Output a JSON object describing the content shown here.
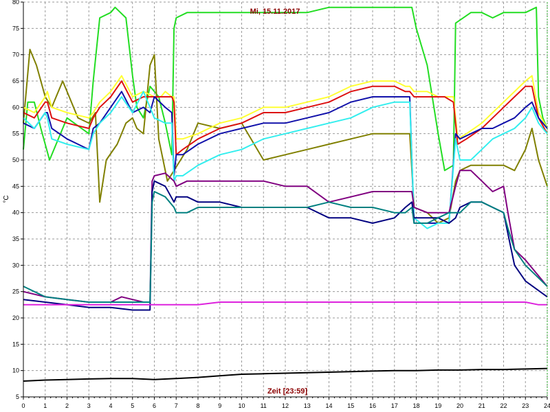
{
  "chart_data": {
    "type": "line",
    "title": "Mi, 15.11.2017",
    "xlabel": "Zeit [23:59]",
    "ylabel": "°C",
    "xlim": [
      0,
      24
    ],
    "ylim": [
      5,
      80
    ],
    "xticks": [
      0,
      1,
      2,
      3,
      4,
      5,
      6,
      7,
      8,
      9,
      10,
      11,
      12,
      13,
      14,
      15,
      16,
      17,
      18,
      19,
      20,
      21,
      22,
      23,
      24
    ],
    "yticks": [
      5,
      10,
      15,
      20,
      25,
      30,
      35,
      40,
      45,
      50,
      55,
      60,
      65,
      70,
      75,
      80
    ],
    "grid": true,
    "series": [
      {
        "color": "#22dd22",
        "x": [
          0,
          0.2,
          0.5,
          0.8,
          1.2,
          2,
          3,
          3.2,
          3.5,
          4,
          4.2,
          4.7,
          5,
          5.2,
          5.5,
          5.8,
          6.2,
          6.5,
          6.8,
          6.9,
          7,
          7.5,
          10,
          13,
          14,
          15,
          16,
          17,
          17.8,
          18,
          18.5,
          19,
          19.3,
          19.7,
          19.8,
          20.5,
          21,
          21.5,
          22,
          22.5,
          23,
          23.5,
          23.6,
          23.8,
          24
        ],
        "y": [
          52,
          61,
          61,
          56,
          50,
          58,
          55,
          65,
          77,
          78,
          79,
          77,
          66,
          60,
          58,
          64,
          62,
          57,
          51,
          75,
          77,
          78,
          78,
          78,
          79,
          79,
          79,
          79,
          79,
          75,
          68,
          55,
          48,
          49,
          76,
          78,
          78,
          77,
          78,
          78,
          78,
          79,
          62,
          58,
          56
        ]
      },
      {
        "color": "#808000",
        "x": [
          0,
          0.3,
          0.6,
          1,
          1.3,
          1.8,
          2.5,
          3,
          3.3,
          3.5,
          3.8,
          4.3,
          4.7,
          5,
          5.2,
          5.5,
          5.8,
          6,
          6.2,
          6.4,
          6.6,
          6.9,
          7.5,
          8,
          9,
          10,
          11,
          12,
          13,
          14,
          15,
          16,
          17,
          17.7,
          17.9,
          18.5,
          19,
          19.5,
          19.8,
          20,
          20.5,
          21,
          22,
          22.5,
          23,
          23.3,
          23.6,
          24
        ],
        "y": [
          57,
          71,
          68,
          62,
          60,
          65,
          58,
          57,
          59,
          42,
          50,
          53,
          57,
          58,
          56,
          55,
          68,
          70,
          54,
          50,
          46,
          48,
          52,
          57,
          56,
          57,
          50,
          51,
          52,
          53,
          54,
          55,
          55,
          55,
          41,
          40,
          38,
          39,
          46,
          48,
          49,
          49,
          49,
          48,
          52,
          56,
          50,
          45
        ]
      },
      {
        "color": "#ffff33",
        "x": [
          0,
          0.5,
          1,
          1.1,
          1.3,
          2,
          3,
          3.2,
          3.5,
          4,
          4.5,
          5,
          5.5,
          6,
          6.3,
          6.5,
          6.8,
          6.9,
          7,
          7.3,
          8,
          9,
          10,
          11,
          12,
          13,
          14,
          15,
          16,
          17,
          17.5,
          17.7,
          17.9,
          18.5,
          19,
          19.3,
          19.7,
          19.9,
          20.3,
          21,
          21.5,
          22,
          22.5,
          23,
          23.3,
          23.6,
          24
        ],
        "y": [
          60,
          59,
          62,
          63,
          60,
          59,
          58,
          59,
          61,
          63,
          66,
          62,
          63,
          62,
          62,
          63,
          62,
          62,
          54,
          54,
          55,
          57,
          58,
          60,
          60,
          61,
          62,
          64,
          65,
          65,
          64,
          64,
          63,
          63,
          62,
          62,
          62,
          54,
          55,
          57,
          59,
          61,
          63,
          65,
          66,
          59,
          56
        ]
      },
      {
        "color": "#dd1111",
        "x": [
          0,
          0.5,
          1,
          1.1,
          1.3,
          2,
          3,
          3.2,
          3.5,
          4,
          4.5,
          5,
          5.5,
          6,
          6.3,
          6.5,
          6.8,
          6.9,
          7,
          7.3,
          8,
          9,
          10,
          11,
          12,
          13,
          14,
          15,
          16,
          17,
          17.5,
          17.7,
          17.9,
          18.5,
          19,
          19.3,
          19.7,
          19.9,
          20.3,
          21,
          21.5,
          22,
          22.5,
          23,
          23.3,
          23.6,
          24
        ],
        "y": [
          59,
          58,
          61,
          61,
          58,
          57,
          56,
          58,
          60,
          62,
          65,
          61,
          62,
          62,
          62,
          62,
          62,
          61,
          51,
          52,
          54,
          56,
          57,
          59,
          59,
          60,
          61,
          63,
          64,
          64,
          63,
          63,
          62,
          62,
          62,
          62,
          61,
          53,
          54,
          56,
          58,
          60,
          62,
          64,
          64,
          58,
          55
        ]
      },
      {
        "color": "#1111aa",
        "x": [
          0,
          0.5,
          1,
          1.1,
          1.3,
          2,
          3,
          3.2,
          3.5,
          4,
          4.5,
          5,
          5.5,
          5.8,
          6,
          6.5,
          6.8,
          6.9,
          7,
          7.3,
          8,
          9,
          10,
          11,
          12,
          13,
          14,
          15,
          16,
          17,
          17.7,
          17.9,
          18.5,
          19,
          19.5,
          19.8,
          20,
          20.5,
          21,
          21.5,
          22,
          22.5,
          23,
          23.3,
          23.6,
          24
        ],
        "y": [
          57,
          56,
          59,
          59,
          56,
          54,
          52,
          56,
          57,
          60,
          63,
          59,
          60,
          59,
          62,
          60,
          59,
          47,
          51,
          51,
          53,
          55,
          56,
          57,
          57,
          58,
          59,
          61,
          62,
          62,
          62,
          38,
          38,
          38,
          38,
          55,
          54,
          55,
          56,
          56,
          57,
          58,
          60,
          61,
          58,
          56
        ]
      },
      {
        "color": "#33eeee",
        "x": [
          0,
          0.5,
          1,
          1.1,
          1.3,
          2,
          3,
          3.2,
          3.5,
          4,
          4.5,
          5,
          5.5,
          5.8,
          6,
          6.5,
          6.8,
          6.9,
          7,
          7.3,
          8,
          9,
          10,
          11,
          12,
          13,
          14,
          15,
          16,
          17,
          17.7,
          17.9,
          18.5,
          19,
          19.5,
          19.8,
          20,
          20.5,
          21,
          21.5,
          22,
          22.5,
          23,
          23.3,
          23.6,
          24
        ],
        "y": [
          58,
          56,
          59,
          58,
          54,
          53,
          52,
          55,
          57,
          59,
          62,
          59,
          63,
          60,
          58,
          57,
          57,
          46,
          47,
          47,
          49,
          51,
          52,
          54,
          55,
          56,
          57,
          58,
          60,
          61,
          61,
          39,
          37,
          38,
          38,
          54,
          50,
          50,
          52,
          54,
          55,
          56,
          58,
          60,
          57,
          55
        ]
      },
      {
        "color": "#800080",
        "x": [
          0,
          1,
          2,
          3,
          4,
          4.5,
          5,
          5.5,
          5.8,
          5.9,
          6,
          6.5,
          6.9,
          7,
          7.5,
          8,
          9,
          10,
          11,
          12,
          13,
          14,
          15,
          16,
          17,
          17.5,
          17.8,
          17.9,
          18.5,
          19,
          19.5,
          19.8,
          20,
          20.5,
          21,
          21.5,
          22,
          22.2,
          22.5,
          23,
          24
        ],
        "y": [
          25,
          24,
          23.5,
          23,
          23,
          24,
          23.5,
          23,
          23,
          46,
          47,
          47.5,
          46,
          45,
          46,
          46,
          46,
          46,
          46,
          45,
          45,
          42,
          43,
          44,
          44,
          44,
          44,
          41,
          40,
          40,
          40,
          45,
          48,
          48,
          46,
          44,
          45,
          40,
          33,
          31,
          26
        ]
      },
      {
        "color": "#000080",
        "x": [
          0,
          1,
          2,
          3,
          4,
          5,
          5.8,
          5.9,
          6,
          6.5,
          6.9,
          7,
          7.5,
          8,
          9,
          10,
          11,
          12,
          13,
          14,
          15,
          16,
          17,
          17.5,
          17.8,
          17.9,
          18.5,
          19,
          19.5,
          19.8,
          20,
          20.5,
          21,
          21.5,
          22,
          22.2,
          22.5,
          23,
          24
        ],
        "y": [
          23.5,
          23,
          22.5,
          22,
          22,
          21.5,
          21.5,
          44,
          46,
          45,
          42,
          43,
          43,
          42,
          42,
          41,
          41,
          41,
          41,
          39,
          39,
          38,
          39,
          41,
          42,
          39,
          39,
          39,
          38,
          39,
          41,
          42,
          42,
          41,
          40,
          36,
          30,
          27,
          24
        ]
      },
      {
        "color": "#008080",
        "x": [
          0,
          1,
          2,
          3,
          4,
          5,
          5.8,
          5.9,
          6,
          6.5,
          6.9,
          7,
          7.5,
          8,
          9,
          10,
          11,
          12,
          13,
          14,
          15,
          16,
          17,
          17.5,
          17.8,
          17.9,
          18.5,
          19,
          19.5,
          19.8,
          20,
          20.5,
          21,
          21.5,
          22,
          22.2,
          22.5,
          23,
          24
        ],
        "y": [
          26,
          24,
          23.5,
          23,
          23,
          23,
          23,
          42,
          44,
          43,
          41,
          40,
          40,
          41,
          41,
          41,
          41,
          41,
          41,
          42,
          41,
          41,
          40,
          40,
          41,
          38,
          38,
          39,
          40,
          40,
          40,
          42,
          42,
          41,
          40,
          37,
          33,
          30,
          26
        ]
      },
      {
        "color": "#dd22dd",
        "x": [
          0,
          1,
          2,
          3,
          4,
          5,
          6,
          7,
          8,
          9,
          10,
          11,
          12,
          13,
          14,
          15,
          16,
          17,
          18,
          19,
          20,
          21,
          22,
          23,
          23.6,
          24
        ],
        "y": [
          22.5,
          22.5,
          22.5,
          22.5,
          22.5,
          22.5,
          22.5,
          22.5,
          22.5,
          23,
          23,
          23,
          23,
          23,
          23,
          23,
          23,
          23,
          23,
          23,
          23,
          23,
          23,
          23,
          22.5,
          22.5
        ]
      },
      {
        "color": "#000000",
        "x": [
          0,
          1,
          2,
          3,
          4,
          5,
          6,
          7,
          8,
          9,
          10,
          11,
          12,
          13,
          14,
          15,
          16,
          17,
          18,
          19,
          20,
          21,
          22,
          23,
          24
        ],
        "y": [
          8,
          8.2,
          8.3,
          8.4,
          8.5,
          8.5,
          8.3,
          8.5,
          8.7,
          9,
          9.3,
          9.4,
          9.5,
          9.6,
          9.7,
          9.8,
          9.9,
          10,
          10,
          10.1,
          10.1,
          10.2,
          10.2,
          10.3,
          10.4
        ]
      }
    ]
  }
}
